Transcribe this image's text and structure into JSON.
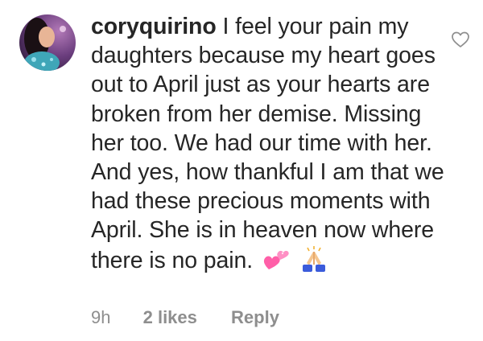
{
  "comment": {
    "username": "coryquirino",
    "text": "I feel your pain my daughters because my heart goes out to April just as your hearts are broken from her demise. Missing her too. We had our time with her. And yes, how thankful I am that we had these precious moments with April. She is in heaven now where there is no pain.",
    "emojis": [
      "two-hearts-icon",
      "folded-hands-icon"
    ],
    "timestamp": "9h",
    "likes_label": "2 likes",
    "reply_label": "Reply"
  },
  "colors": {
    "text": "#262626",
    "meta": "#8e8e8e",
    "heart_pink": "#ff5fa8",
    "hands_blue": "#3b5bdb",
    "skin": "#f5c58e"
  }
}
